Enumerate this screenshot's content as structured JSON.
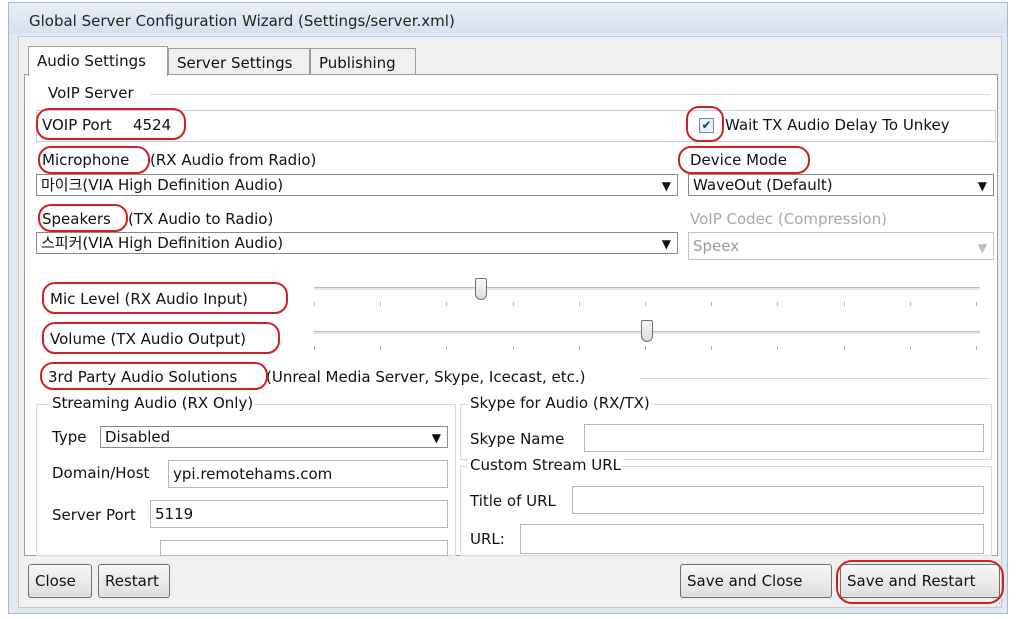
{
  "window": {
    "title": "Global Server Configuration Wizard (Settings/server.xml)"
  },
  "tabs": [
    {
      "label": "Audio Settings",
      "active": true
    },
    {
      "label": "Server Settings",
      "active": false
    },
    {
      "label": "Publishing",
      "active": false
    }
  ],
  "voip": {
    "group_label": "VoIP Server",
    "port_label": "VOIP Port",
    "port_value": "4524",
    "wait_tx_label": "Wait TX Audio Delay To Unkey",
    "wait_tx_checked": true
  },
  "microphone": {
    "label_main": "Microphone",
    "label_rest": "(RX Audio from Radio)",
    "selected": "마이크(VIA High Definition Audio)"
  },
  "device_mode": {
    "label": "Device Mode",
    "selected": "WaveOut (Default)"
  },
  "speakers": {
    "label_main": "Speakers",
    "label_rest": "(TX Audio to Radio)",
    "selected": "스피커(VIA High Definition Audio)"
  },
  "codec": {
    "label": "VoIP Codec (Compression)",
    "selected": "Speex",
    "enabled": false
  },
  "mic_level": {
    "label": "Mic Level (RX Audio Input)",
    "value": 0.25
  },
  "volume": {
    "label": "Volume (TX Audio Output)",
    "value": 0.5
  },
  "third_party": {
    "label_main": "3rd Party Audio Solutions",
    "label_rest": "(Unreal Media Server, Skype, Icecast, etc.)"
  },
  "streaming": {
    "group_label": "Streaming Audio (RX Only)",
    "type_label": "Type",
    "type_selected": "Disabled",
    "domain_label": "Domain/Host",
    "domain_value": "ypi.remotehams.com",
    "port_label": "Server Port",
    "port_value": "5119"
  },
  "skype": {
    "group_label": "Skype for Audio (RX/TX)",
    "name_label": "Skype Name",
    "name_value": ""
  },
  "custom_stream": {
    "group_label": "Custom Stream URL",
    "title_label": "Title of URL",
    "title_value": "",
    "url_label": "URL:",
    "url_value": ""
  },
  "buttons": {
    "close": "Close",
    "restart": "Restart",
    "save_close": "Save and Close",
    "save_restart": "Save and Restart"
  },
  "colors": {
    "highlight": "#d02020",
    "titlebar": "#dfe8f3"
  }
}
